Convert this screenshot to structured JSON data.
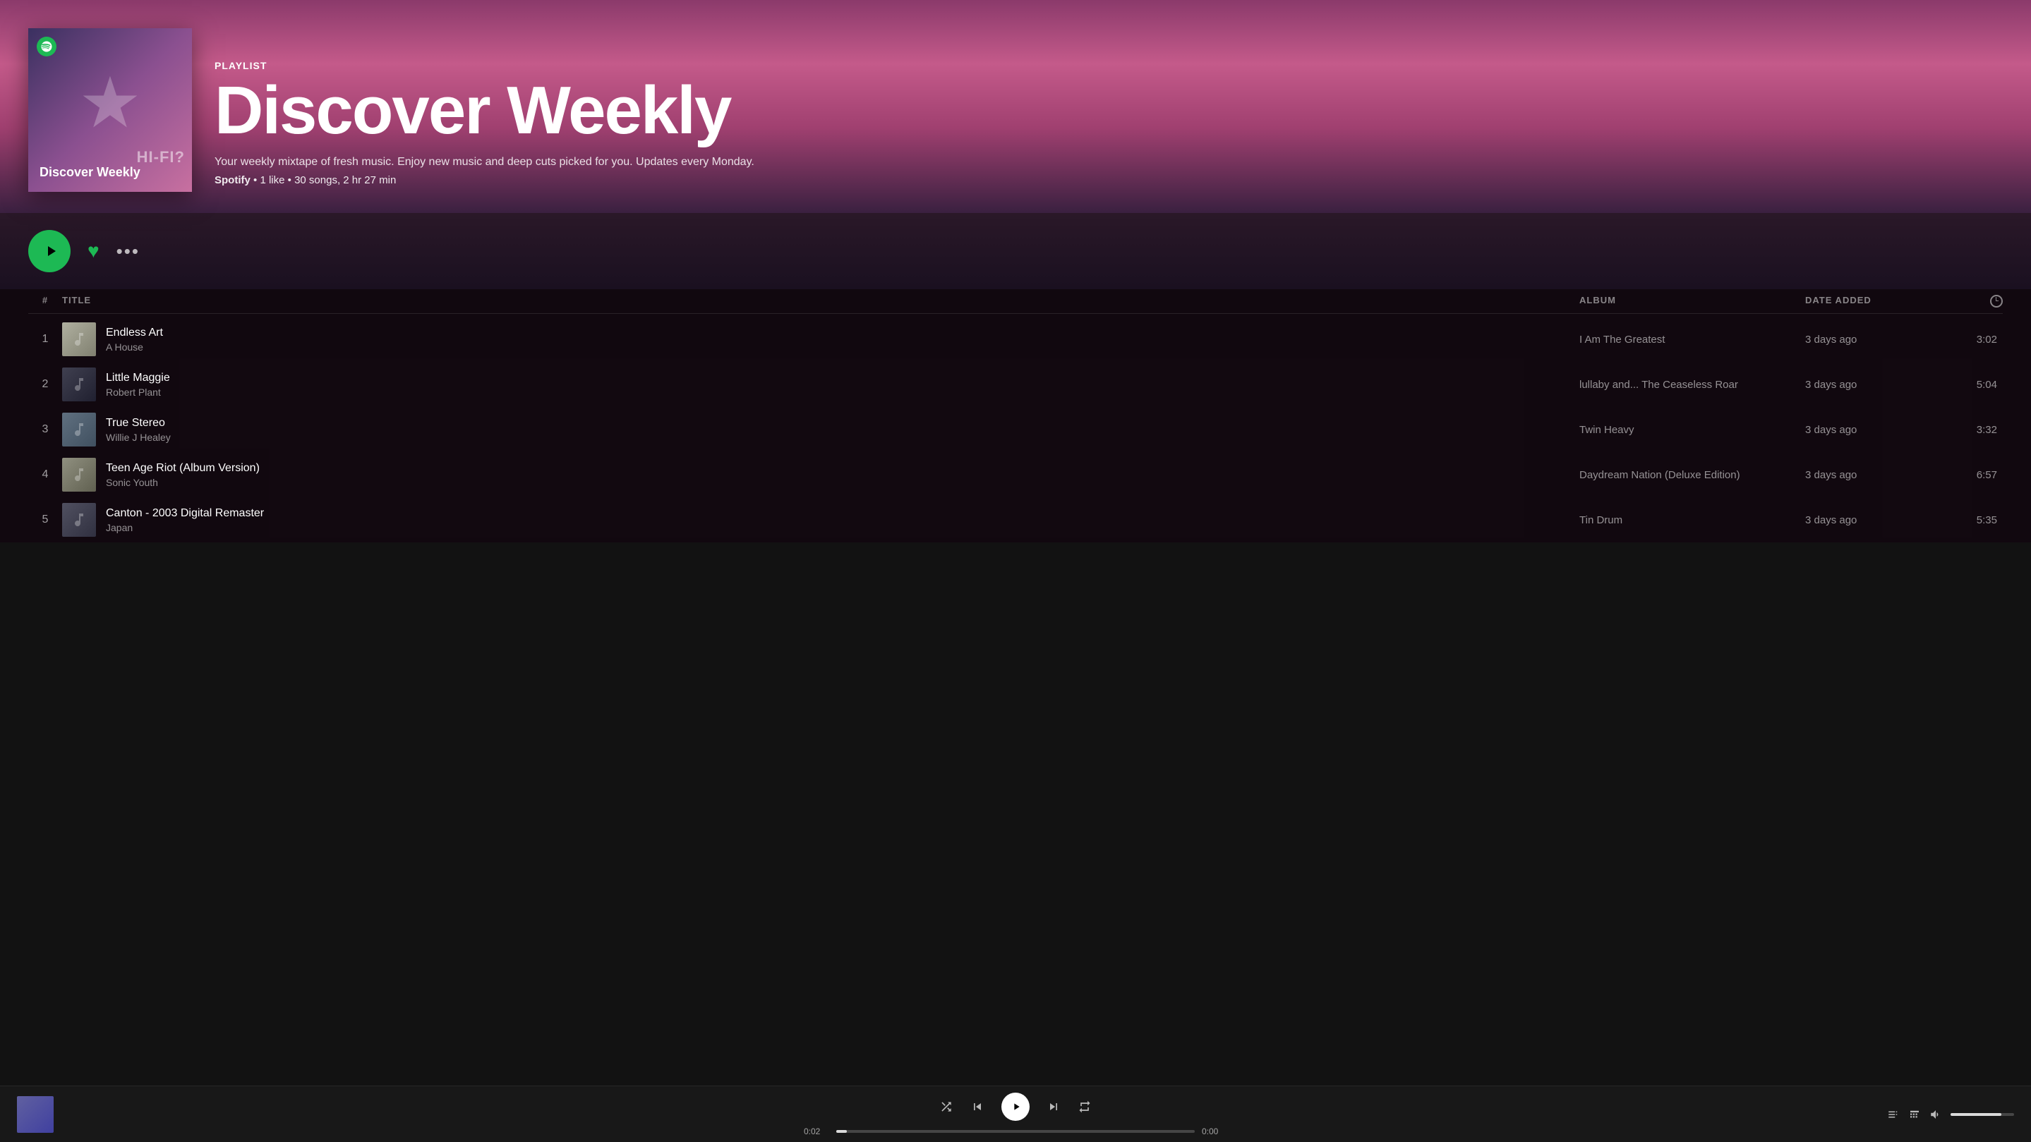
{
  "header": {
    "playlist_type": "PLAYLIST",
    "playlist_title": "Discover Weekly",
    "description": "Your weekly mixtape of fresh music. Enjoy new music and deep cuts picked for you. Updates every Monday.",
    "spotify_label": "Spotify",
    "meta_likes": "1 like",
    "meta_songs": "30 songs, 2 hr 27 min",
    "cover_label": "Discover Weekly",
    "hi_fi_label": "HI-FI?"
  },
  "controls": {
    "play_label": "▶",
    "more_label": "•••"
  },
  "table": {
    "col_num": "#",
    "col_title": "TITLE",
    "col_album": "ALBUM",
    "col_date": "DATE ADDED",
    "col_dur": "⏱"
  },
  "tracks": [
    {
      "num": "1",
      "name": "Endless Art",
      "artist": "A House",
      "album": "I Am The Greatest",
      "date_added": "3 days ago",
      "duration": "3:02",
      "thumb_class": "track-thumb-1"
    },
    {
      "num": "2",
      "name": "Little Maggie",
      "artist": "Robert Plant",
      "album": "lullaby and... The Ceaseless Roar",
      "date_added": "3 days ago",
      "duration": "5:04",
      "thumb_class": "track-thumb-2"
    },
    {
      "num": "3",
      "name": "True Stereo",
      "artist": "Willie J Healey",
      "album": "Twin Heavy",
      "date_added": "3 days ago",
      "duration": "3:32",
      "thumb_class": "track-thumb-3"
    },
    {
      "num": "4",
      "name": "Teen Age Riot (Album Version)",
      "artist": "Sonic Youth",
      "album": "Daydream Nation (Deluxe Edition)",
      "date_added": "3 days ago",
      "duration": "6:57",
      "thumb_class": "track-thumb-4"
    },
    {
      "num": "5",
      "name": "Canton - 2003 Digital Remaster",
      "artist": "Japan",
      "album": "Tin Drum",
      "date_added": "3 days ago",
      "duration": "5:35",
      "thumb_class": "track-thumb-5"
    }
  ],
  "player": {
    "current_time": "0:02",
    "total_time": "0:00",
    "progress_pct": 3
  }
}
